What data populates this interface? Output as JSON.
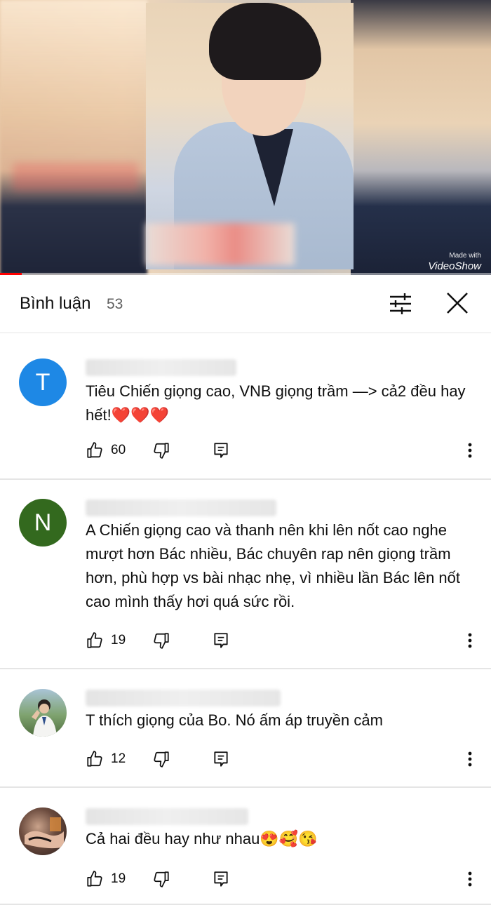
{
  "video": {
    "watermark_small": "Made with",
    "watermark_brand": "VideoShow",
    "progress": 0.044
  },
  "comments_header": {
    "title": "Bình luận",
    "count": "53"
  },
  "comments": [
    {
      "avatar_letter": "T",
      "avatar_color": "#1e88e5",
      "text": "Tiêu Chiến giọng cao, VNB giọng trầm —> cả2 đều hay hết!❤️❤️❤️",
      "likes": "60"
    },
    {
      "avatar_letter": "N",
      "avatar_color": "#33691e",
      "text": "A Chiến giọng cao và thanh nên khi lên nốt cao nghe mượt hơn Bác nhiều, Bác chuyên rap nên giọng trầm hơn, phù hợp vs bài nhạc nhẹ, vì nhiều lần Bác lên nốt cao mình thấy hơi quá sức rồi.",
      "likes": "19"
    },
    {
      "avatar_letter": "",
      "avatar_color": "#8fb3a0",
      "text": "T thích giọng của Bo. Nó ấm áp truyền cảm",
      "likes": "12"
    },
    {
      "avatar_letter": "",
      "avatar_color": "#3a2a2a",
      "text": "Cả hai đều hay như nhau😍🥰😘",
      "likes": "19"
    }
  ],
  "icons": {
    "like": "thumb-up-icon",
    "dislike": "thumb-down-icon",
    "reply": "reply-icon",
    "more": "more-vert-icon",
    "sort": "sort-filter-icon",
    "close": "close-icon"
  }
}
